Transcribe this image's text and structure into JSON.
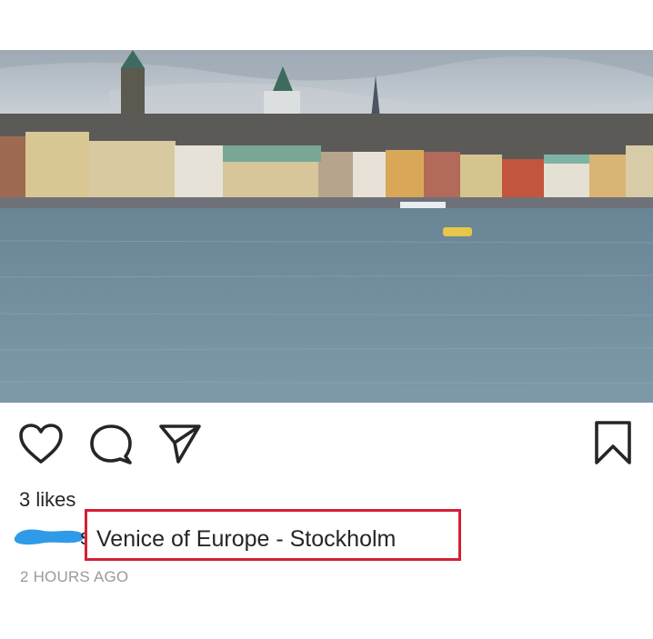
{
  "post": {
    "image_alt": "Stockholm waterfront skyline across the water",
    "likes_text": "3 likes",
    "caption": "Venice of Europe - Stockholm",
    "username_visible_fragment": "s",
    "timestamp": "2 HOURS AGO"
  },
  "icons": {
    "like": "heart-icon",
    "comment": "comment-bubble-icon",
    "share": "paper-plane-icon",
    "save": "bookmark-icon"
  },
  "colors": {
    "highlight_border": "#d51f35",
    "redaction": "#2f9be8",
    "text": "#262626",
    "muted": "#9a9a9a"
  }
}
